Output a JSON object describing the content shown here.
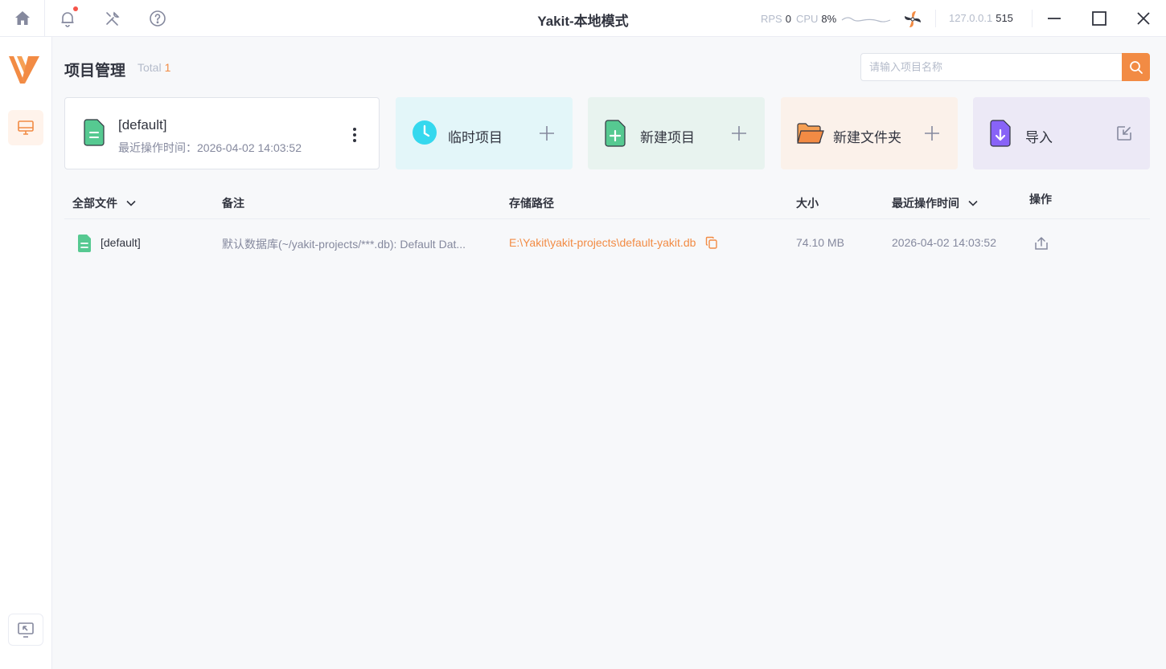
{
  "app": {
    "title": "Yakit-本地模式",
    "rps_label": "RPS",
    "rps_value": "0",
    "cpu_label": "CPU",
    "cpu_value": "8%",
    "engine_host": "127.0.0.1",
    "engine_port": "515"
  },
  "icons": {
    "home": "home-icon",
    "bell": "bell-icon",
    "tools": "tools-icon",
    "help": "help-icon",
    "logo": "yakit-logo",
    "project_manage": "monitor-icon",
    "screen_back": "screen-exit-icon"
  },
  "colors": {
    "accent": "#f28b44",
    "notify_dot": "#f6544a",
    "temp_bg": "#e3f6f9",
    "new_bg": "#e8f3ef",
    "folder_bg": "#fbf1ea",
    "import_bg": "#ece9f6"
  },
  "header": {
    "title": "项目管理",
    "total_label": "Total",
    "total_count": "1",
    "search_placeholder": "请输入项目名称"
  },
  "current_project": {
    "name": "[default]",
    "time_label": "最近操作时间：2026-04-02 14:03:52"
  },
  "actions": [
    {
      "label": "临时项目"
    },
    {
      "label": "新建项目"
    },
    {
      "label": "新建文件夹"
    },
    {
      "label": "导入"
    }
  ],
  "table": {
    "columns": {
      "name": "全部文件",
      "note": "备注",
      "path": "存储路径",
      "size": "大小",
      "time": "最近操作时间",
      "op": "操作"
    },
    "rows": [
      {
        "name": "[default]",
        "note": "默认数据库(~/yakit-projects/***.db): Default Dat...",
        "path": "E:\\Yakit\\yakit-projects\\default-yakit.db",
        "size": "74.10 MB",
        "time": "2026-04-02 14:03:52"
      }
    ]
  }
}
